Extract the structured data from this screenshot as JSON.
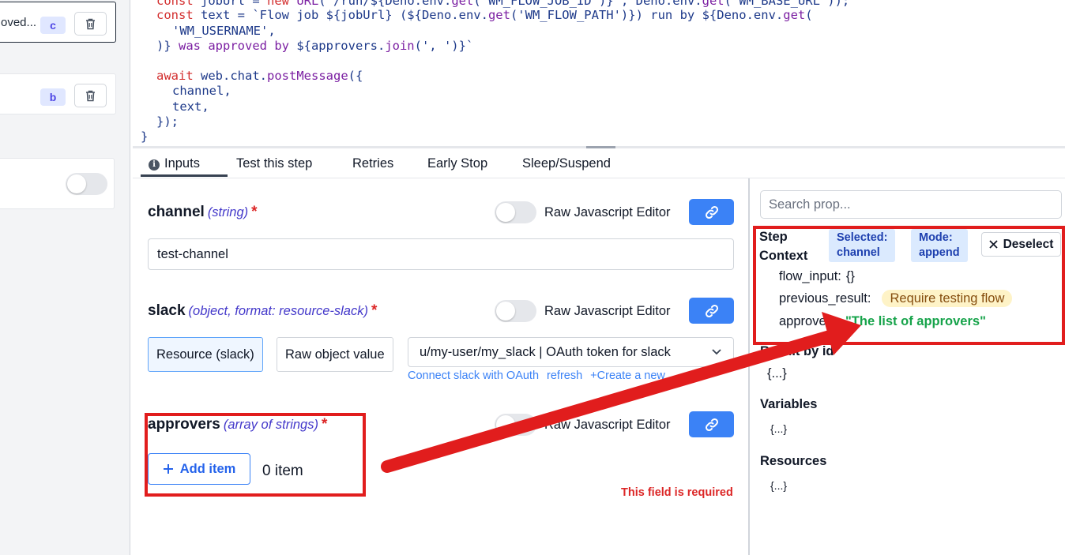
{
  "sidebar": {
    "steps": [
      {
        "label": "oved...",
        "badge": "c"
      },
      {
        "label": "",
        "badge": "b"
      }
    ]
  },
  "code": {
    "lines": [
      "const jobUrl = new URL(`/run/${Deno.env.get('WM_FLOW_JOB_ID')}`, Deno.env.get('WM_BASE_URL'));",
      "const text = `Flow job ${jobUrl} (${Deno.env.get('WM_FLOW_PATH')}) run by ${Deno.env.get(",
      "'WM_USERNAME',",
      ")} was approved by ${approvers.join(', ')}`",
      "",
      "await web.chat.postMessage({",
      "channel,",
      "text,",
      "});",
      "}"
    ]
  },
  "tabs": [
    {
      "label": "Inputs"
    },
    {
      "label": "Test this step"
    },
    {
      "label": "Retries"
    },
    {
      "label": "Early Stop"
    },
    {
      "label": "Sleep/Suspend"
    }
  ],
  "form": {
    "raw_editor_label": "Raw Javascript Editor",
    "channel": {
      "name": "channel",
      "type": "(string)",
      "required_mark": "*",
      "value": "test-channel"
    },
    "slack": {
      "name": "slack",
      "type": "(object, format: resource-slack)",
      "required_mark": "*",
      "resource_button": "Resource (slack)",
      "raw_button": "Raw object value",
      "selected_resource": "u/my-user/my_slack | OAuth token for slack",
      "links": [
        "Connect slack with OAuth",
        "refresh",
        "+Create a new"
      ]
    },
    "approvers": {
      "name": "approvers",
      "type": "(array of strings)",
      "required_mark": "*",
      "add_item": "Add item",
      "count": "0 item",
      "error": "This field is required"
    }
  },
  "right_panel": {
    "search_placeholder": "Search prop...",
    "step_context_title": "Step Context",
    "chip_selected": [
      "Selected:",
      "channel"
    ],
    "chip_mode": [
      "Mode:",
      "append"
    ],
    "deselect": "Deselect",
    "context": {
      "flow_input_key": "flow_input:",
      "flow_input_val": "{}",
      "previous_result_key": "previous_result:",
      "previous_result_val": "Require testing flow",
      "approvers_key": "approvers:",
      "approvers_val": "\"The list of approvers\""
    },
    "result_by_id_title": "Result by id",
    "result_by_id_val": "{...}",
    "variables_title": "Variables",
    "variables_val": "{...}",
    "resources_title": "Resources",
    "resources_val": "{...}"
  },
  "colors": {
    "accent": "#3b82f6",
    "annotation": "#e11d1d",
    "error": "#dc2626",
    "success": "#16a34a"
  }
}
